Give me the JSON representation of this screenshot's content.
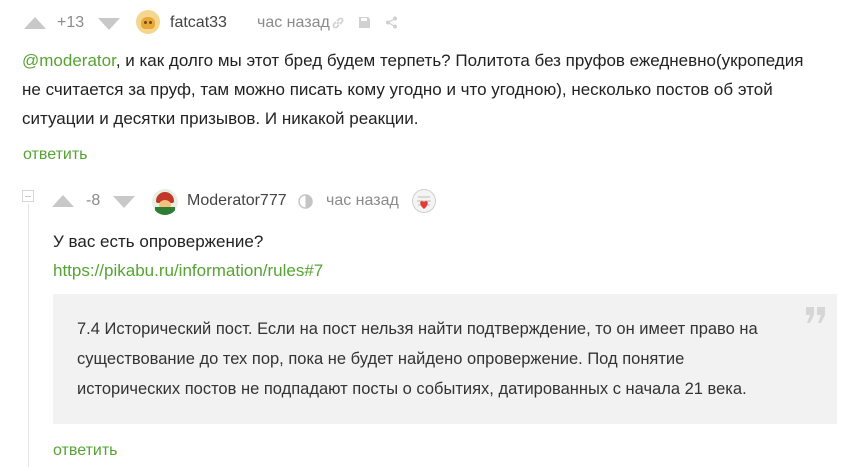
{
  "comment1": {
    "rating": "+13",
    "author": "fatcat33",
    "time": "час назад",
    "mention": "@moderator",
    "line1": ", и как долго мы этот бред будем терпеть? Политота без пруфов ежедневно(укропедия",
    "line2": "не считается за пруф, там можно писать кому угодно и что угодною), несколько постов об этой",
    "line3": "ситуации и десятки призывов. И никакой реакции.",
    "reply_label": "ответить"
  },
  "comment2": {
    "rating": "-8",
    "author": "Moderator777",
    "time": "час назад",
    "text": "У вас есть опровержение?",
    "link": "https://pikabu.ru/information/rules#7",
    "quote_line1": "7.4 Исторический пост. Если на пост нельзя найти подтверждение, то он имеет право на",
    "quote_line2": "существование до тех пор, пока не будет найдено опровержение. Под понятие",
    "quote_line3": "исторических постов не подпадают посты о событиях, датированных с начала 21 века.",
    "reply_label": "ответить"
  },
  "icons": {
    "upvote": "arrow-up-icon",
    "downvote": "arrow-down-icon",
    "link": "link-icon",
    "save": "save-icon",
    "share": "share-icon",
    "collapse": "collapse-icon",
    "quote": "quote-icon",
    "moderator_badge": "moderator-badge-icon",
    "award": "award-icon"
  },
  "colors": {
    "accent_green": "#56a334",
    "muted": "#8b8b8b",
    "quote_bg": "#f2f2f2"
  }
}
